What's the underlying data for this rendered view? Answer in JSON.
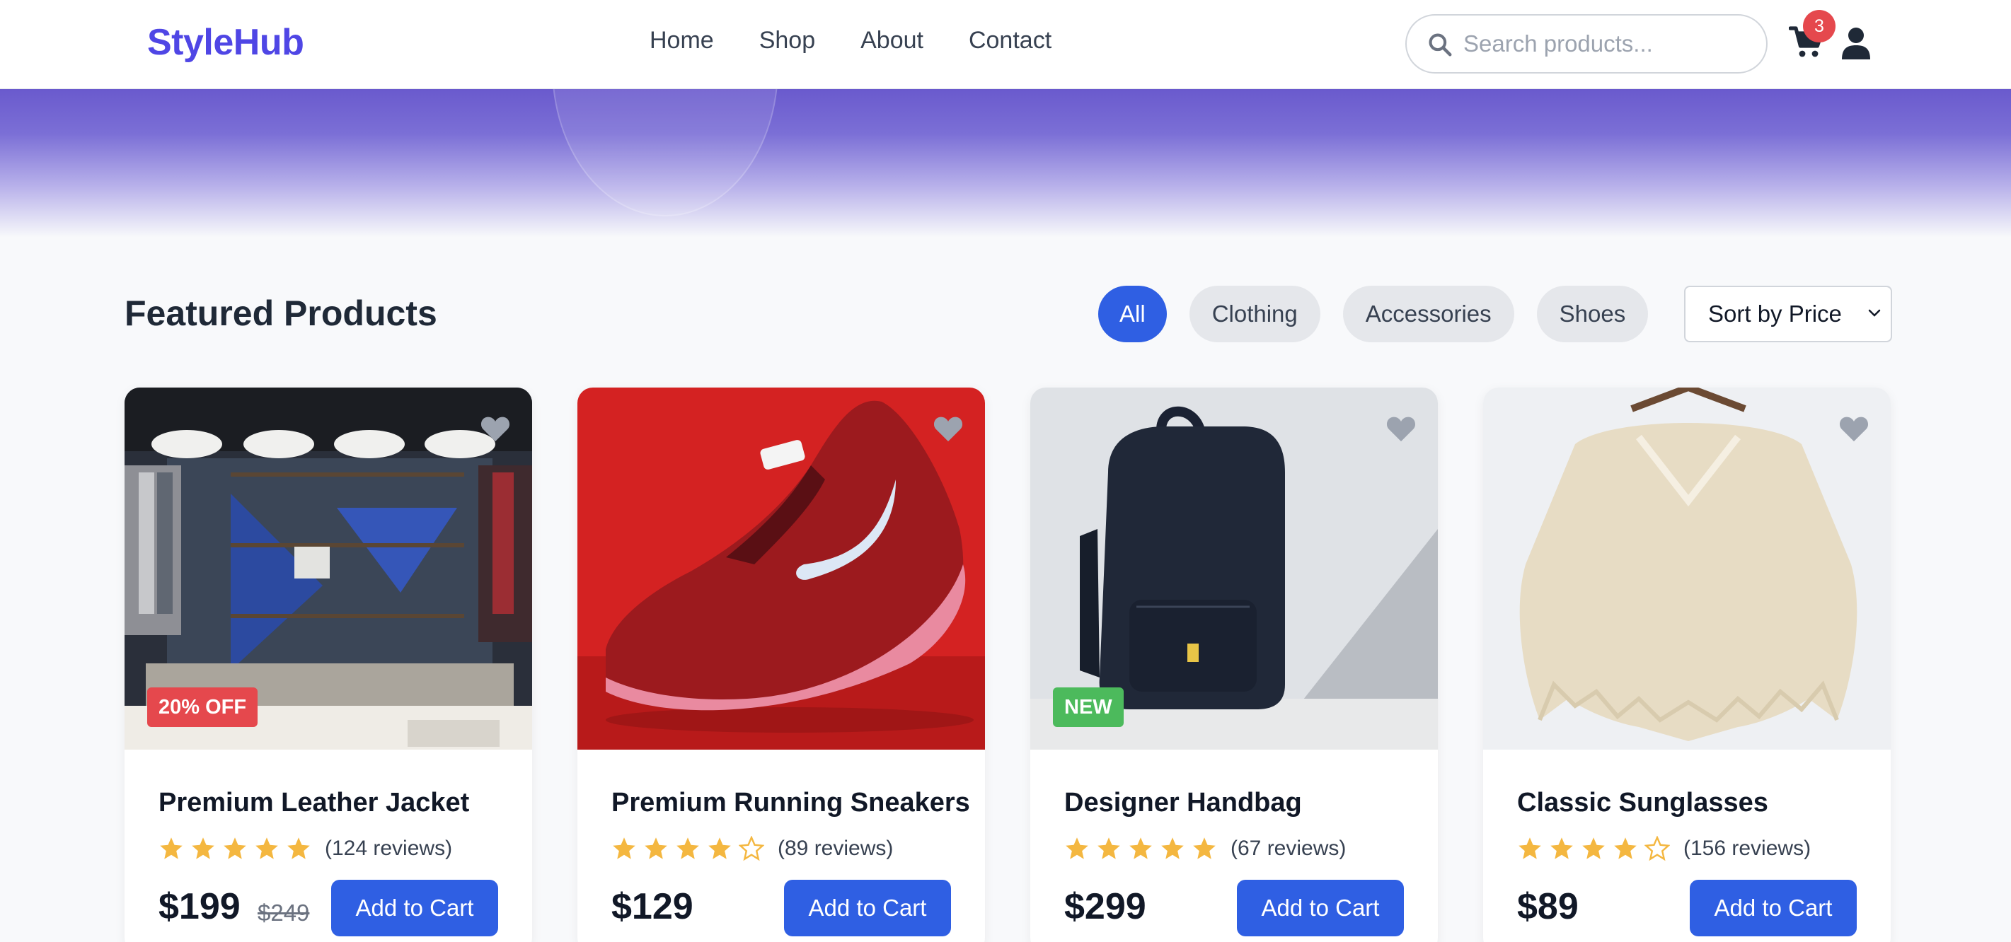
{
  "brand": {
    "name": "StyleHub",
    "color": "#4f46e5"
  },
  "nav": {
    "links": [
      {
        "label": "Home"
      },
      {
        "label": "Shop"
      },
      {
        "label": "About"
      },
      {
        "label": "Contact"
      }
    ]
  },
  "search": {
    "placeholder": "Search products...",
    "value": "",
    "icon": "search-icon"
  },
  "cart": {
    "icon": "cart-icon",
    "count": "3"
  },
  "user": {
    "icon": "user-icon"
  },
  "section": {
    "title": "Featured Products",
    "filters": [
      {
        "label": "All",
        "active": true
      },
      {
        "label": "Clothing",
        "active": false
      },
      {
        "label": "Accessories",
        "active": false
      },
      {
        "label": "Shoes",
        "active": false
      }
    ],
    "sort": {
      "selected": "Sort by Price"
    }
  },
  "products": [
    {
      "name": "Premium Leather Jacket",
      "image": "clothing store interior",
      "badge": "20% OFF",
      "badge_type": "sale",
      "rating": 5,
      "reviews": "(124 reviews)",
      "price": "$199",
      "old_price": "$249",
      "cta": "Add to Cart"
    },
    {
      "name": "Premium Running Sneakers",
      "image": "red running sneaker",
      "badge": "",
      "rating": 4,
      "reviews": "(89 reviews)",
      "price": "$129",
      "cta": "Add to Cart"
    },
    {
      "name": "Designer Handbag",
      "image": "dark navy backpack",
      "badge": "NEW",
      "badge_type": "new",
      "rating": 5,
      "reviews": "(67 reviews)",
      "price": "$299",
      "cta": "Add to Cart"
    },
    {
      "name": "Classic Sunglasses",
      "image": "cream knit poncho on hanger",
      "badge": "",
      "rating": 4,
      "reviews": "(156 reviews)",
      "price": "$89",
      "cta": "Add to Cart"
    }
  ],
  "colors": {
    "primary": "#2f5fe3",
    "sale": "#e5484d",
    "new": "#4cba5c",
    "star": "#f4b740",
    "hero": "#6a5acd"
  }
}
